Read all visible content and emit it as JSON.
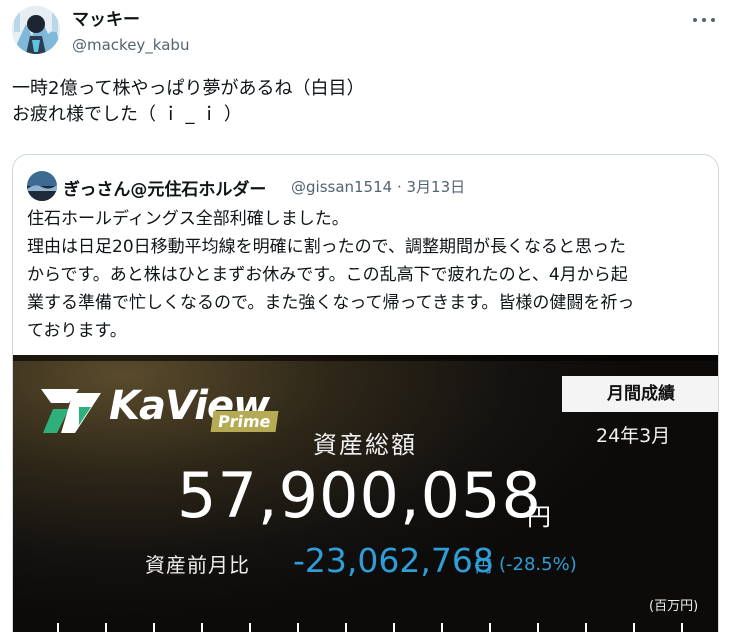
{
  "tweet": {
    "display_name": "マッキー",
    "handle": "@mackey_kabu",
    "more_icon": "more-horizontal-icon",
    "lines": [
      "一時2億って株やっぱり夢があるね（白目）",
      "お疲れ様でした（ ｉ _ ｉ ）"
    ]
  },
  "quote": {
    "display_name": "ぎっさん@元住石ホルダー",
    "meta": "@gissan1514 · 3月13日",
    "lines": [
      "住石ホールディングス全部利確しました。",
      "理由は日足20日移動平均線を明確に割ったので、調整期間が長くなると思った",
      "からです。あと株はひとまずお休みです。この乱高下で疲れたのと、4月から起",
      "業する準備で忙しくなるので。また強くなって帰ってきます。皆様の健闘を祈っ",
      "ております。"
    ]
  },
  "media": {
    "logo_word": "KaView",
    "logo_tag": "Prime",
    "badge": "月間成績",
    "date": "24年3月",
    "total_label": "資産総額",
    "total_amount": "57,900,058",
    "total_unit": "円",
    "diff_label": "資産前月比",
    "diff_amount": "-23,062,768",
    "diff_unit": "円",
    "diff_pct": "(-28.5%)",
    "axis_unit": "(百万円)",
    "colors": {
      "accent": "#2f9ed7",
      "logo_tag": "#b6ab55",
      "logo_green": "#2fb07a"
    }
  }
}
